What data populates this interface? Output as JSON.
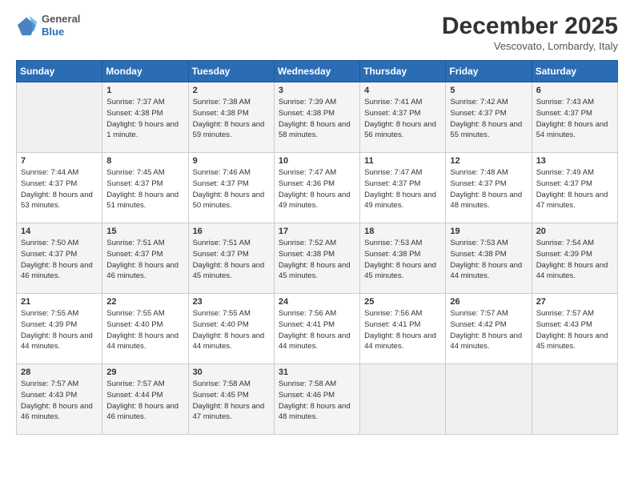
{
  "header": {
    "logo": {
      "general": "General",
      "blue": "Blue"
    },
    "title": "December 2025",
    "location": "Vescovato, Lombardy, Italy"
  },
  "days_of_week": [
    "Sunday",
    "Monday",
    "Tuesday",
    "Wednesday",
    "Thursday",
    "Friday",
    "Saturday"
  ],
  "weeks": [
    [
      {
        "num": "",
        "sunrise": "",
        "sunset": "",
        "daylight": ""
      },
      {
        "num": "1",
        "sunrise": "Sunrise: 7:37 AM",
        "sunset": "Sunset: 4:38 PM",
        "daylight": "Daylight: 9 hours and 1 minute."
      },
      {
        "num": "2",
        "sunrise": "Sunrise: 7:38 AM",
        "sunset": "Sunset: 4:38 PM",
        "daylight": "Daylight: 8 hours and 59 minutes."
      },
      {
        "num": "3",
        "sunrise": "Sunrise: 7:39 AM",
        "sunset": "Sunset: 4:38 PM",
        "daylight": "Daylight: 8 hours and 58 minutes."
      },
      {
        "num": "4",
        "sunrise": "Sunrise: 7:41 AM",
        "sunset": "Sunset: 4:37 PM",
        "daylight": "Daylight: 8 hours and 56 minutes."
      },
      {
        "num": "5",
        "sunrise": "Sunrise: 7:42 AM",
        "sunset": "Sunset: 4:37 PM",
        "daylight": "Daylight: 8 hours and 55 minutes."
      },
      {
        "num": "6",
        "sunrise": "Sunrise: 7:43 AM",
        "sunset": "Sunset: 4:37 PM",
        "daylight": "Daylight: 8 hours and 54 minutes."
      }
    ],
    [
      {
        "num": "7",
        "sunrise": "Sunrise: 7:44 AM",
        "sunset": "Sunset: 4:37 PM",
        "daylight": "Daylight: 8 hours and 53 minutes."
      },
      {
        "num": "8",
        "sunrise": "Sunrise: 7:45 AM",
        "sunset": "Sunset: 4:37 PM",
        "daylight": "Daylight: 8 hours and 51 minutes."
      },
      {
        "num": "9",
        "sunrise": "Sunrise: 7:46 AM",
        "sunset": "Sunset: 4:37 PM",
        "daylight": "Daylight: 8 hours and 50 minutes."
      },
      {
        "num": "10",
        "sunrise": "Sunrise: 7:47 AM",
        "sunset": "Sunset: 4:36 PM",
        "daylight": "Daylight: 8 hours and 49 minutes."
      },
      {
        "num": "11",
        "sunrise": "Sunrise: 7:47 AM",
        "sunset": "Sunset: 4:37 PM",
        "daylight": "Daylight: 8 hours and 49 minutes."
      },
      {
        "num": "12",
        "sunrise": "Sunrise: 7:48 AM",
        "sunset": "Sunset: 4:37 PM",
        "daylight": "Daylight: 8 hours and 48 minutes."
      },
      {
        "num": "13",
        "sunrise": "Sunrise: 7:49 AM",
        "sunset": "Sunset: 4:37 PM",
        "daylight": "Daylight: 8 hours and 47 minutes."
      }
    ],
    [
      {
        "num": "14",
        "sunrise": "Sunrise: 7:50 AM",
        "sunset": "Sunset: 4:37 PM",
        "daylight": "Daylight: 8 hours and 46 minutes."
      },
      {
        "num": "15",
        "sunrise": "Sunrise: 7:51 AM",
        "sunset": "Sunset: 4:37 PM",
        "daylight": "Daylight: 8 hours and 46 minutes."
      },
      {
        "num": "16",
        "sunrise": "Sunrise: 7:51 AM",
        "sunset": "Sunset: 4:37 PM",
        "daylight": "Daylight: 8 hours and 45 minutes."
      },
      {
        "num": "17",
        "sunrise": "Sunrise: 7:52 AM",
        "sunset": "Sunset: 4:38 PM",
        "daylight": "Daylight: 8 hours and 45 minutes."
      },
      {
        "num": "18",
        "sunrise": "Sunrise: 7:53 AM",
        "sunset": "Sunset: 4:38 PM",
        "daylight": "Daylight: 8 hours and 45 minutes."
      },
      {
        "num": "19",
        "sunrise": "Sunrise: 7:53 AM",
        "sunset": "Sunset: 4:38 PM",
        "daylight": "Daylight: 8 hours and 44 minutes."
      },
      {
        "num": "20",
        "sunrise": "Sunrise: 7:54 AM",
        "sunset": "Sunset: 4:39 PM",
        "daylight": "Daylight: 8 hours and 44 minutes."
      }
    ],
    [
      {
        "num": "21",
        "sunrise": "Sunrise: 7:55 AM",
        "sunset": "Sunset: 4:39 PM",
        "daylight": "Daylight: 8 hours and 44 minutes."
      },
      {
        "num": "22",
        "sunrise": "Sunrise: 7:55 AM",
        "sunset": "Sunset: 4:40 PM",
        "daylight": "Daylight: 8 hours and 44 minutes."
      },
      {
        "num": "23",
        "sunrise": "Sunrise: 7:55 AM",
        "sunset": "Sunset: 4:40 PM",
        "daylight": "Daylight: 8 hours and 44 minutes."
      },
      {
        "num": "24",
        "sunrise": "Sunrise: 7:56 AM",
        "sunset": "Sunset: 4:41 PM",
        "daylight": "Daylight: 8 hours and 44 minutes."
      },
      {
        "num": "25",
        "sunrise": "Sunrise: 7:56 AM",
        "sunset": "Sunset: 4:41 PM",
        "daylight": "Daylight: 8 hours and 44 minutes."
      },
      {
        "num": "26",
        "sunrise": "Sunrise: 7:57 AM",
        "sunset": "Sunset: 4:42 PM",
        "daylight": "Daylight: 8 hours and 44 minutes."
      },
      {
        "num": "27",
        "sunrise": "Sunrise: 7:57 AM",
        "sunset": "Sunset: 4:43 PM",
        "daylight": "Daylight: 8 hours and 45 minutes."
      }
    ],
    [
      {
        "num": "28",
        "sunrise": "Sunrise: 7:57 AM",
        "sunset": "Sunset: 4:43 PM",
        "daylight": "Daylight: 8 hours and 46 minutes."
      },
      {
        "num": "29",
        "sunrise": "Sunrise: 7:57 AM",
        "sunset": "Sunset: 4:44 PM",
        "daylight": "Daylight: 8 hours and 46 minutes."
      },
      {
        "num": "30",
        "sunrise": "Sunrise: 7:58 AM",
        "sunset": "Sunset: 4:45 PM",
        "daylight": "Daylight: 8 hours and 47 minutes."
      },
      {
        "num": "31",
        "sunrise": "Sunrise: 7:58 AM",
        "sunset": "Sunset: 4:46 PM",
        "daylight": "Daylight: 8 hours and 48 minutes."
      },
      {
        "num": "",
        "sunrise": "",
        "sunset": "",
        "daylight": ""
      },
      {
        "num": "",
        "sunrise": "",
        "sunset": "",
        "daylight": ""
      },
      {
        "num": "",
        "sunrise": "",
        "sunset": "",
        "daylight": ""
      }
    ]
  ]
}
